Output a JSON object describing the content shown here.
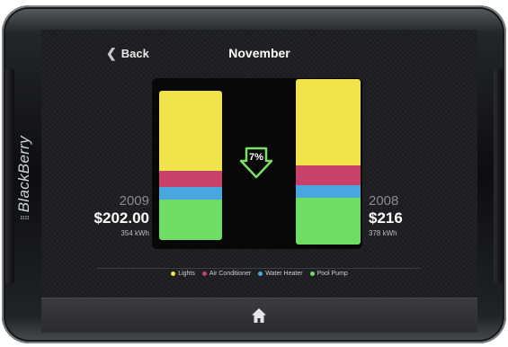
{
  "device": {
    "brand": "BlackBerry",
    "brand_mark": "⁞⁞"
  },
  "header": {
    "back_label": "Back",
    "title": "November"
  },
  "comparison": {
    "change_percent": "7%"
  },
  "left_bar": {
    "year": "2009",
    "amount": "$202.00",
    "kwh": "354 kWh",
    "segments": {
      "Lights": 89,
      "Air Conditioner": 18,
      "Water Heater": 14,
      "Pool Pump": 45
    }
  },
  "right_bar": {
    "year": "2008",
    "amount": "$216",
    "kwh": "378 kWh",
    "segments": {
      "Lights": 96,
      "Air Conditioner": 22,
      "Water Heater": 14,
      "Pool Pump": 52
    }
  },
  "legend": [
    {
      "label": "Lights",
      "color": "#f1e34b"
    },
    {
      "label": "Air Conditioner",
      "color": "#c8416a"
    },
    {
      "label": "Water Heater",
      "color": "#4aa6df"
    },
    {
      "label": "Pool Pump",
      "color": "#6fdc63"
    }
  ],
  "colors": {
    "arrow_green": "#7ddc6b",
    "screen_bg": "#1e1f22"
  },
  "bottom_bar": {
    "icon": "home-icon"
  }
}
